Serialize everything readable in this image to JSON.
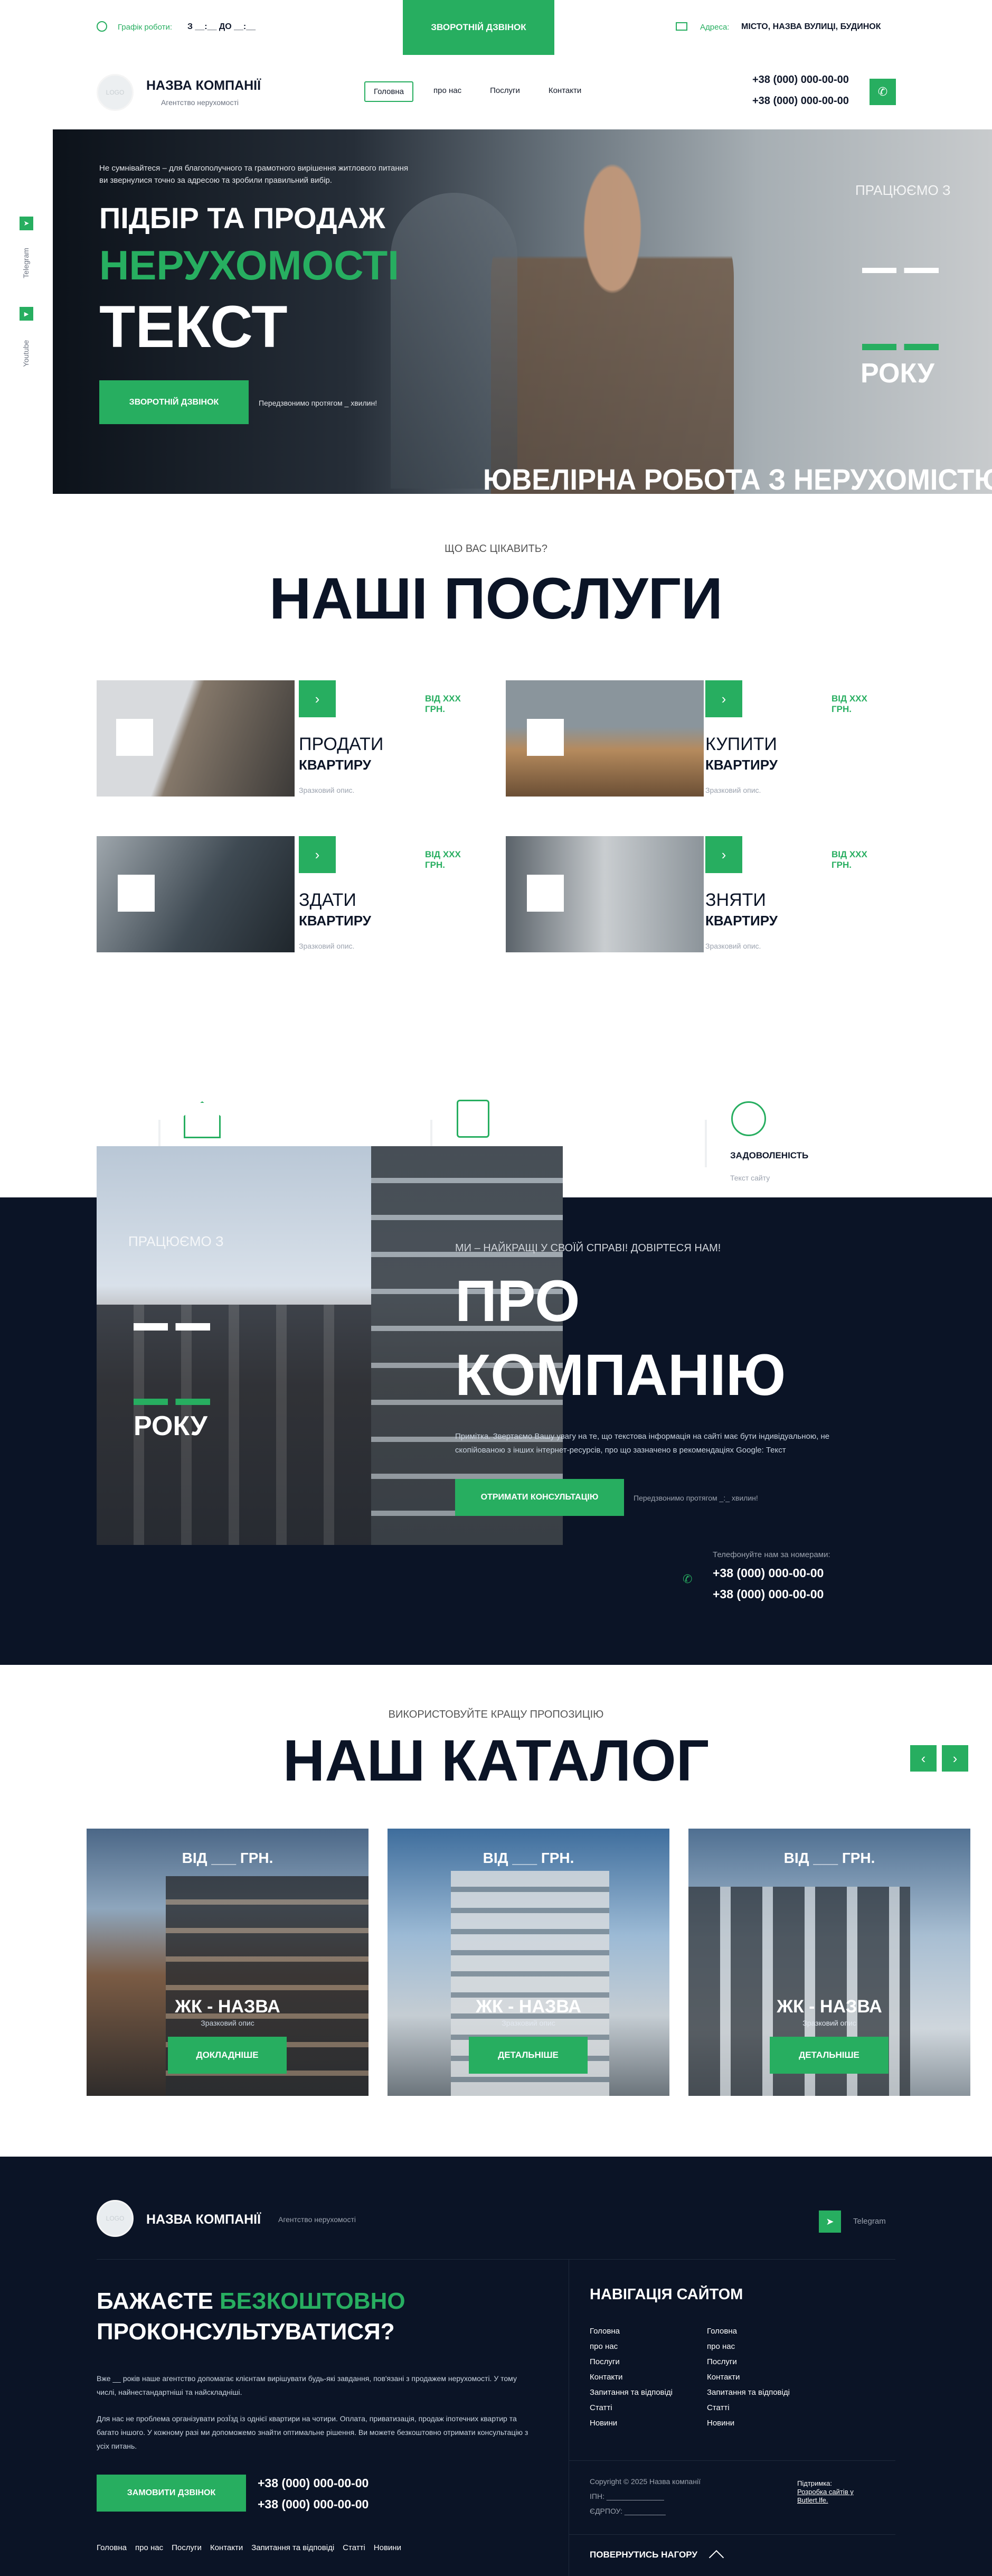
{
  "topbar": {
    "schedule_label": "Графік роботи:",
    "schedule_value": "З __:__ ДО __:__",
    "callback_label": "ЗВОРОТНІЙ ДЗВІНОК",
    "address_label": "Адреса:",
    "address_value": "МІСТО, НАЗВА ВУЛИЦІ, БУДИНОК"
  },
  "header": {
    "logo_text": "LOGO",
    "company_name": "НАЗВА КОМПАНІЇ",
    "company_sub": "Агентство нерухомості",
    "nav": [
      "Головна",
      "про нас",
      "Послуги",
      "Контакти"
    ],
    "phones": [
      "+38 (000) 000-00-00",
      "+38 (000) 000-00-00"
    ]
  },
  "social": [
    "Telegram",
    "Youtube"
  ],
  "hero": {
    "intro": "Не сумнівайтеся – для благополучного та грамотного вирішення житлового питання ви звернулися точно за адресою та зробили правильний вибір.",
    "title_line1": "ПІДБІР ТА ПРОДАЖ",
    "title_line2": "НЕРУХОМОСТІ",
    "title_line3": "ТЕКСТ",
    "button": "ЗВОРОТНІЙ ДЗВІНОК",
    "callback_note": "Передзвонимо протягом _ хвилин!",
    "working_since": "ПРАЦЮЄМО З",
    "year_label": "РОКУ",
    "bottom_text": "ЮВЕЛІРНА РОБОТА З НЕРУХОМІСТЮ"
  },
  "services": {
    "eyebrow": "ЩО ВАС ЦІКАВИТЬ?",
    "title": "НАШІ ПОСЛУГИ",
    "items": [
      {
        "price": "ВІД ХХХ ГРН.",
        "action": "ПРОДАТИ",
        "object": "КВАРТИРУ",
        "desc": "Зразковий опис."
      },
      {
        "price": "ВІД ХХХ ГРН.",
        "action": "КУПИТИ",
        "object": "КВАРТИРУ",
        "desc": "Зразковий опис."
      },
      {
        "price": "ВІД ХХХ ГРН.",
        "action": "ЗДАТИ",
        "object": "КВАРТИРУ",
        "desc": "Зразковий опис."
      },
      {
        "price": "ВІД ХХХ ГРН.",
        "action": "ЗНЯТИ",
        "object": "КВАРТИРУ",
        "desc": "Зразковий опис."
      }
    ]
  },
  "advantages": {
    "third_title": "ЗАДОВОЛЕНІСТЬ",
    "third_text": "Текст сайту"
  },
  "about": {
    "working_since": "ПРАЦЮЄМО З",
    "year_label": "РОКУ",
    "eyebrow": "МИ – НАЙКРАЩІ У СВОЇЙ СПРАВІ! ДОВІРТЕСЯ НАМ!",
    "title_line1": "ПРО",
    "title_line2": "КОМПАНІЮ",
    "note": "Примітка. Звертаємо Вашу увагу на те, що текстова інформація на сайті має бути індивідуальною, не скопійованою з інших інтернет-ресурсів, про що зазначено в рекомендаціях Google: Текст",
    "button": "ОТРИМАТИ КОНСУЛЬТАЦІЮ",
    "callback_note": "Передзвонимо протягом _:_ хвилин!",
    "phone_label": "Телефонуйте нам за номерами:",
    "phones": [
      "+38 (000) 000-00-00",
      "+38 (000) 000-00-00"
    ]
  },
  "catalog": {
    "eyebrow": "ВИКОРИСТОВУЙТЕ КРАЩУ ПРОПОЗИЦІЮ",
    "title": "НАШ КАТАЛОГ",
    "items": [
      {
        "price": "ВІД ___ ГРН.",
        "name": "ЖК - НАЗВА",
        "sub": "Зразковий опис",
        "button": "ДОКЛАДНІШЕ"
      },
      {
        "price": "ВІД ___ ГРН.",
        "name": "ЖК - НАЗВА",
        "sub": "Зразковий опис",
        "button": "ДЕТАЛЬНІШЕ"
      },
      {
        "price": "ВІД ___ ГРН.",
        "name": "ЖК - НАЗВА",
        "sub": "Зразковий опис",
        "button": "ДЕТАЛЬНІШЕ"
      }
    ]
  },
  "footer": {
    "logo_text": "LOGO",
    "company_name": "НАЗВА КОМПАНІЇ",
    "company_sub": "Агентство нерухомості",
    "telegram": "Telegram",
    "cta_line1_a": "БАЖАЄТЕ ",
    "cta_line1_b": "БЕЗКОШТОВНО",
    "cta_line2": "ПРОКОНСУЛЬТУВАТИСЯ?",
    "para1": "Вже __ років наше агентство допомагає клієнтам вирішувати будь-які завдання, пов'язані з продажем нерухомості. У тому числі, найнестандартніші та найскладніші.",
    "para2": "Для нас не проблема організувати розЇзд із однієї квартири на чотири. Оплата, приватизація, продаж іпотечних квартир та багато іншого. У кожному разі ми допоможемо знайти оптимальне рішення. Ви можете безкоштовно отримати консультацію з усіх питань.",
    "button": "ЗАМОВИТИ ДЗВІНОК",
    "phones": [
      "+38 (000) 000-00-00",
      "+38 (000) 000-00-00"
    ],
    "bottom_nav": [
      "Головна",
      "про нас",
      "Послуги",
      "Контакти",
      "Запитання та відповіді",
      "Статті",
      "Новини"
    ],
    "nav_title": "НАВІГАЦІЯ САЙТОМ",
    "nav_col1": [
      "Головна",
      "про нас",
      "Послуги",
      "Контакти",
      "Запитання та відповіді",
      "Статті",
      "Новини"
    ],
    "nav_col2": [
      "Головна",
      "про нас",
      "Послуги",
      "Контакти",
      "Запитання та відповіді",
      "Статті",
      "Новини"
    ],
    "copyright": "Copyright © 2025 Назва компанії",
    "ipn": "ІПН: ______________",
    "edrpou": "ЄДРПОУ: __________",
    "support_label": "Підтримка:",
    "support_link": "Розробка сайтів у Butlert.lfe.",
    "back_to_top": "ПОВЕРНУТИСЬ НАГОРУ"
  }
}
